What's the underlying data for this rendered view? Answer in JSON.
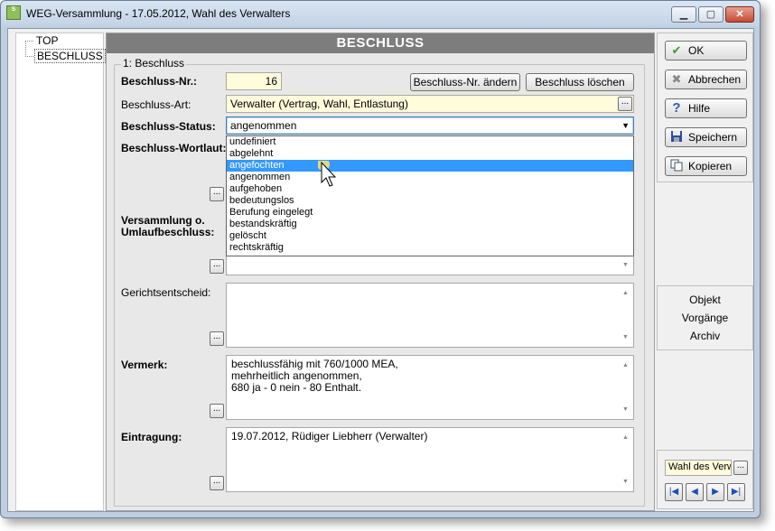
{
  "window": {
    "title": "WEG-Versammlung - 17.05.2012,  Wahl des Verwalters",
    "icon_text": "S",
    "min_glyph": "▁",
    "max_glyph": "▢",
    "close_glyph": "✕"
  },
  "tree": {
    "items": [
      {
        "label": "TOP"
      },
      {
        "label": "BESCHLUSS",
        "selected": true
      }
    ]
  },
  "panel": {
    "header": "BESCHLUSS",
    "group_caption": "1: Beschluss",
    "nr": {
      "label": "Beschluss-Nr.:",
      "value": "16"
    },
    "btn_change": "Beschluss-Nr. ändern",
    "btn_delete": "Beschluss löschen",
    "art": {
      "label": "Beschluss-Art:",
      "value": "Verwalter (Vertrag, Wahl, Entlastung)"
    },
    "status": {
      "label": "Beschluss-Status:",
      "value": "angenommen",
      "options": [
        "undefiniert",
        "abgelehnt",
        "angefochten",
        "angenommen",
        "aufgehoben",
        "bedeutungslos",
        "Berufung eingelegt",
        "bestandskräftig",
        "gelöscht",
        "rechtskräftig"
      ],
      "highlighted": "angefochten"
    },
    "wortlaut": {
      "label": "Beschluss-Wortlaut:"
    },
    "versammlung": {
      "label_line1": "Versammlung o.",
      "label_line2": "Umlaufbeschluss:"
    },
    "gericht": {
      "label": "Gerichtsentscheid:"
    },
    "vermerk": {
      "label": "Vermerk:",
      "lines": [
        "beschlussfähig mit 760/1000 MEA,",
        "mehrheitlich angenommen,",
        "680 ja - 0 nein - 80 Enthalt."
      ]
    },
    "eintragung": {
      "label": "Eintragung:",
      "value": "19.07.2012, Rüdiger Liebherr (Verwalter)"
    },
    "dots_label": "..."
  },
  "actions": {
    "ok": "OK",
    "cancel": "Abbrechen",
    "help": "Hilfe",
    "save": "Speichern",
    "copy": "Kopieren"
  },
  "nav_links": {
    "objekt": "Objekt",
    "vorgaenge": "Vorgänge",
    "archiv": "Archiv"
  },
  "bottom": {
    "record_value": "Wahl des Verwalters",
    "first": "|◀",
    "prev": "◀",
    "next": "▶",
    "last": "▶|"
  },
  "colors": {
    "highlight": "#3399ff",
    "field_yellow": "#fffbdb",
    "header_gray": "#7d7d7d"
  }
}
